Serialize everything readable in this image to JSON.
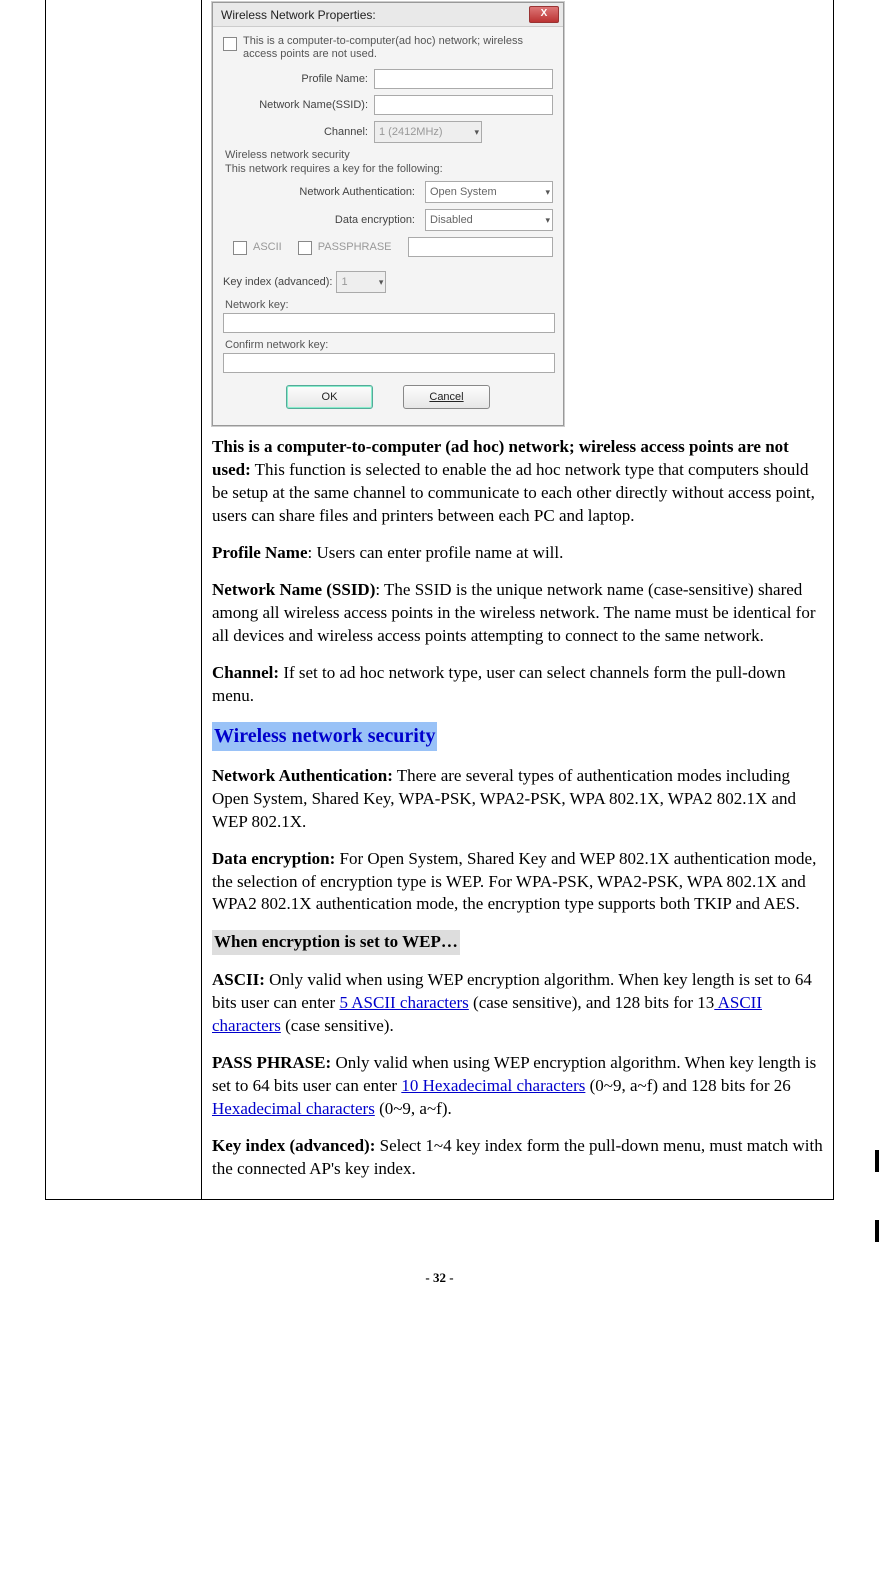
{
  "dialog": {
    "title": "Wireless Network Properties:",
    "adhocText": "This is a computer-to-computer(ad hoc) network; wireless access points are not used.",
    "profileNameLabel": "Profile Name:",
    "ssidLabel": "Network Name(SSID):",
    "channelLabel": "Channel:",
    "channelValue": "1 (2412MHz)",
    "securitySection": "Wireless network security",
    "securitySub": "This network requires a key for the following:",
    "netAuthLabel": "Network Authentication:",
    "netAuthValue": "Open System",
    "dataEncLabel": "Data encryption:",
    "dataEncValue": "Disabled",
    "asciiLabel": "ASCII",
    "passphraseLabel": "PASSPHRASE",
    "keyIndexLabel": "Key index (advanced):",
    "keyIndexValue": "1",
    "networkKeyLabel": "Network key:",
    "confirmKeyLabel": "Confirm network key:",
    "okLabel": "OK",
    "cancelLabel": "Cancel",
    "closeGlyph": "X"
  },
  "body": {
    "p1_bold": "This is a computer-to-computer (ad hoc) network; wireless access points are not used:",
    "p1_rest": " This function is selected to enable the ad hoc network type that computers should be setup at the same channel to communicate to each other directly without access point, users can share files and printers between each PC and laptop.",
    "p2_bold": "Profile Name",
    "p2_rest": ": Users can enter profile name at will.",
    "p3_bold": "Network Name (SSID)",
    "p3_rest": ": The SSID is the unique network name (case-sensitive) shared among all wireless access points in the wireless network. The name must be identical for all devices and wireless access points attempting to connect to the same network.",
    "p4_bold": "Channel:",
    "p4_rest": " If set to ad hoc network type, user can select channels form the pull-down menu.",
    "heading_sec": "Wireless network security",
    "p5_bold": "Network Authentication:",
    "p5_rest": " There are several types of authentication modes including Open System, Shared Key, WPA-PSK, WPA2-PSK, WPA 802.1X, WPA2 802.1X and WEP 802.1X.",
    "p6_bold": "Data encryption:",
    "p6_rest": " For Open System, Shared Key and WEP 802.1X authentication mode, the selection of encryption type is WEP. For WPA-PSK, WPA2-PSK, WPA 802.1X and WPA2 802.1X authentication mode, the encryption type supports both TKIP and AES.",
    "heading_wep": "When encryption is set to WEP…",
    "p7_bold": "ASCII:",
    "p7_a": " Only valid when using WEP encryption algorithm. When key length is set to 64 bits user can enter ",
    "p7_link1": "5 ASCII characters",
    "p7_b": " (case sensitive), and 128 bits for 13",
    "p7_link2": " ASCII characters",
    "p7_c": " (case sensitive).",
    "p8_bold": "PASS PHRASE:",
    "p8_a": " Only valid when using WEP encryption algorithm. When key length is set to 64 bits user can enter ",
    "p8_link1": "10 Hexadecimal characters",
    "p8_b": " (0~9, a~f) and 128 bits for 26 ",
    "p8_link2": "Hexadecimal characters",
    "p8_c": " (0~9, a~f).",
    "p9_bold": "Key index (advanced):",
    "p9_rest": " Select 1~4 key index form the pull-down menu, must match with the connected AP's key index."
  },
  "pageNumber": "- 32 -",
  "chevron": "▾"
}
